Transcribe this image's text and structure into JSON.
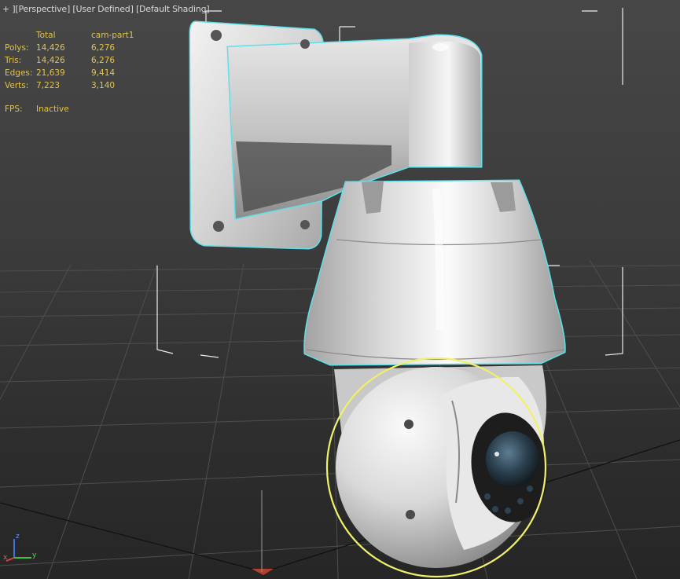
{
  "viewport": {
    "label": {
      "plus": "+ ]",
      "view": "[Perspective",
      "camera": "] [User Defined",
      "shading": "] [Default Shading",
      "end": "]"
    },
    "stats": {
      "headers": {
        "total": "Total",
        "selection": "cam-part1"
      },
      "rows": [
        {
          "label": "Polys:",
          "total": "14,426",
          "selection": "6,276"
        },
        {
          "label": "Tris:",
          "total": "14,426",
          "selection": "6,276"
        },
        {
          "label": "Edges:",
          "total": "21,639",
          "selection": "9,414"
        },
        {
          "label": "Verts:",
          "total": "7,223",
          "selection": "3,140"
        }
      ],
      "fps_label": "FPS:",
      "fps_value": "Inactive"
    },
    "gizmo": {
      "z": "z",
      "x": "x",
      "y": "y"
    },
    "colors": {
      "stats_text": "#e3c34a",
      "selection_outline": "#5ee0ea",
      "subobject_outline": "#f0f06a",
      "gizmo_x": "#e04040",
      "gizmo_y": "#40c040",
      "gizmo_z": "#4070e0"
    }
  }
}
